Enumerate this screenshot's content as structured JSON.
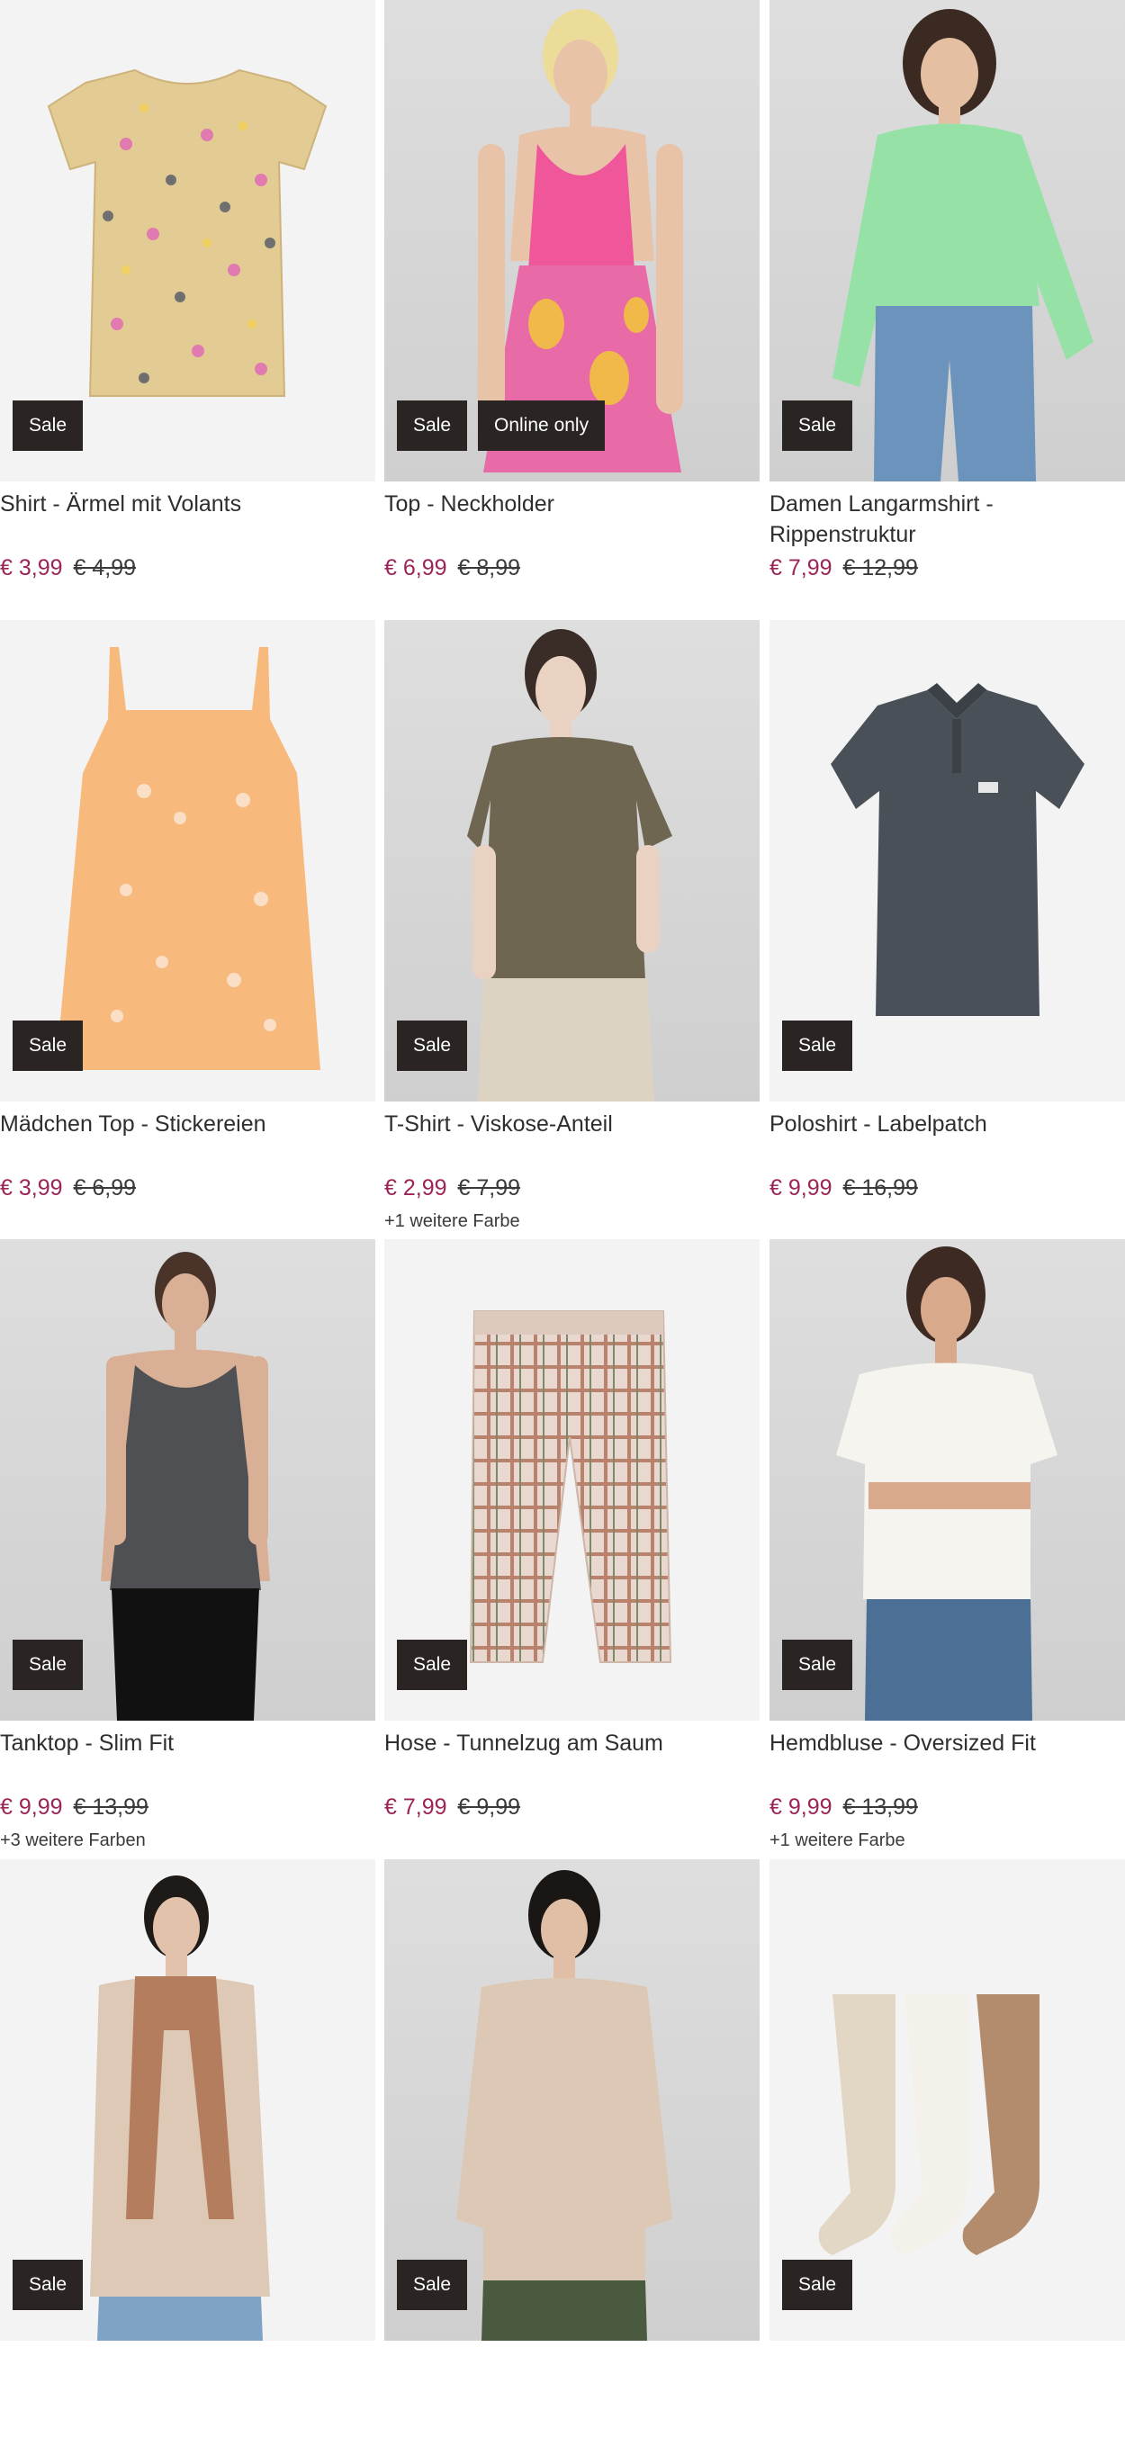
{
  "products": [
    {
      "title": "Shirt - Ärmel mit Volants",
      "price": "€ 3,99",
      "old_price": "€ 4,99",
      "badges": [
        "Sale"
      ],
      "variants": "",
      "image": "beige-kids-tshirt-print"
    },
    {
      "title": "Top - Neckholder",
      "price": "€ 6,99",
      "old_price": "€ 8,99",
      "badges": [
        "Sale",
        "Online only"
      ],
      "variants": "",
      "image": "pink-neckholder-top-model"
    },
    {
      "title": "Damen Langarmshirt - Rippenstruktur",
      "price": "€ 7,99",
      "old_price": "€ 12,99",
      "badges": [
        "Sale"
      ],
      "variants": "",
      "image": "green-longsleeve-model"
    },
    {
      "title": "Mädchen Top - Stickereien",
      "price": "€ 3,99",
      "old_price": "€ 6,99",
      "badges": [
        "Sale"
      ],
      "variants": "",
      "image": "orange-girls-top"
    },
    {
      "title": "T-Shirt - Viskose-Anteil",
      "price": "€ 2,99",
      "old_price": "€ 7,99",
      "badges": [
        "Sale"
      ],
      "variants": "+1 weitere Farbe",
      "image": "olive-tshirt-model"
    },
    {
      "title": "Poloshirt - Labelpatch",
      "price": "€ 9,99",
      "old_price": "€ 16,99",
      "badges": [
        "Sale"
      ],
      "variants": "",
      "image": "grey-poloshirt"
    },
    {
      "title": "Tanktop - Slim Fit",
      "price": "€ 9,99",
      "old_price": "€ 13,99",
      "badges": [
        "Sale"
      ],
      "variants": "+3 weitere Farben",
      "image": "grey-tanktop-model"
    },
    {
      "title": "Hose - Tunnelzug am Saum",
      "price": "€ 7,99",
      "old_price": "€ 9,99",
      "badges": [
        "Sale"
      ],
      "variants": "",
      "image": "checked-trousers"
    },
    {
      "title": "Hemdbluse - Oversized Fit",
      "price": "€ 9,99",
      "old_price": "€ 13,99",
      "badges": [
        "Sale"
      ],
      "variants": "+1 weitere Farbe",
      "image": "white-blouse-model"
    },
    {
      "title": "",
      "price": "",
      "old_price": "",
      "badges": [
        "Sale"
      ],
      "variants": "",
      "image": "scarf-model"
    },
    {
      "title": "",
      "price": "",
      "old_price": "",
      "badges": [
        "Sale"
      ],
      "variants": "",
      "image": "beige-blouse-model"
    },
    {
      "title": "",
      "price": "",
      "old_price": "",
      "badges": [
        "Sale"
      ],
      "variants": "",
      "image": "socks-3-pack"
    }
  ],
  "colors": {
    "sale_price": "#9c2458",
    "badge_bg": "#2a2422",
    "badge_text": "#ffffff"
  }
}
